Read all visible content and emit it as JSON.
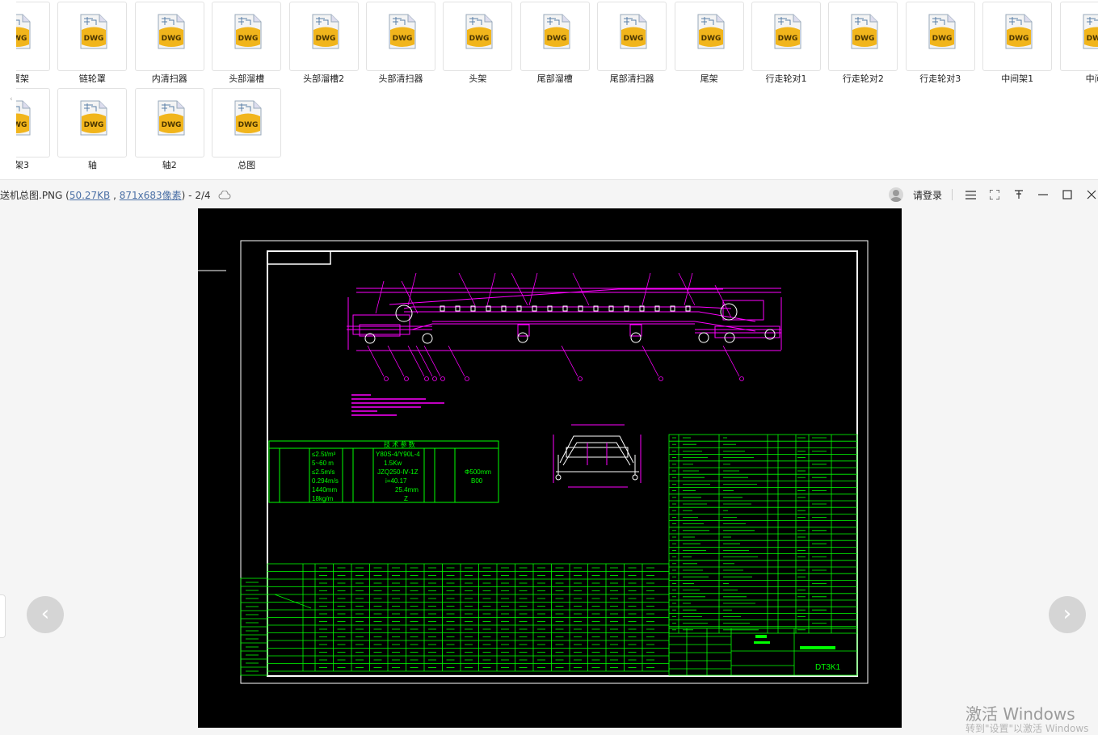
{
  "files": {
    "row1": [
      "置架",
      "链轮罩",
      "内清扫器",
      "头部溜槽",
      "头部溜槽2",
      "头部清扫器",
      "头架",
      "尾部溜槽",
      "尾部清扫器",
      "尾架",
      "行走轮对1",
      "行走轮对2",
      "行走轮对3",
      "中间架1",
      "中间"
    ],
    "row2": [
      "架3",
      "轴",
      "轴2",
      "总图"
    ],
    "icon_text": "DWG"
  },
  "viewer": {
    "filename_prefix": "送机总图.PNG (",
    "size": "50.27KB",
    "comma": " , ",
    "dims": "871x683像素",
    "suffix": ") - 2/4",
    "login": "请登录"
  },
  "drawing": {
    "title_block_code": "DT3K1",
    "params_header": "技 术 参 数",
    "params": [
      "≤2.5t/m³",
      "5~60 m",
      "≤2.5m/s",
      "0.294m/s",
      "1440mm",
      "18kg/m",
      "Y80S-4/Y90L-4",
      "1.5Kw",
      "JZQ250-Ⅳ-1Z",
      "i=40.17",
      "25.4mm",
      "Z",
      "Φ500mm",
      "B00"
    ]
  },
  "watermark": {
    "line1": "激活 Windows",
    "line2": "转到\"设置\"以激活 Windows"
  },
  "colors": {
    "magenta": "#ff00ff",
    "green": "#00ff00",
    "white": "#ffffff",
    "yellow": "#ffff00"
  }
}
